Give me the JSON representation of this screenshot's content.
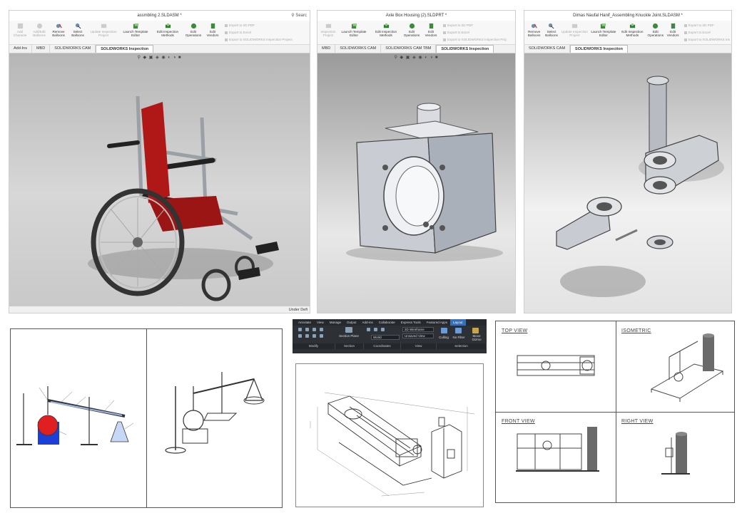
{
  "sw1": {
    "title": "assmbling 2.SLDASM *",
    "search": "Searc",
    "ribbon": [
      "Add Characte",
      "Add/Edit Balloons",
      "Remove Balloons",
      "Select Balloons",
      "Update Inspection Project",
      "Launch Template Editor",
      "Edit Inspection Methods",
      "Edit Operations",
      "Edit Vendors"
    ],
    "exports": [
      "Export to 2D PDF",
      "Export to Excel",
      "Export to SOLIDWORKS Inspection Project"
    ],
    "tabs": [
      "Add-Ins",
      "MBD",
      "SOLIDWORKS CAM",
      "SOLIDWORKS Inspection"
    ],
    "status": "Under Defi"
  },
  "sw2": {
    "title": "Axle Box Housing (2).SLDPRT *",
    "ribbon": [
      "Inspection Project",
      "Launch Template Editor",
      "Edit Inspection Methods",
      "Edit Operations",
      "Edit Vendors"
    ],
    "exports": [
      "Export to 2D PDF",
      "Export to Excel",
      "Export to SOLIDWORKS Inspection Proj"
    ],
    "tabs": [
      "MBD",
      "SOLIDWORKS CAM",
      "SOLIDWORKS CAM TBM",
      "SOLIDWORKS Inspection"
    ]
  },
  "sw3": {
    "title": "Dimas Naufal Hanif_Assembling Knuckle Joint.SLDASM *",
    "ribbon": [
      "Remove Balloons",
      "Select Balloons",
      "Update Inspection Project",
      "Launch Template Editor",
      "Edit Inspection Methods",
      "Edit Operations",
      "Edit Vendors"
    ],
    "exports": [
      "Export to 2D PDF",
      "Export to Excel",
      "Export to SOLIDWORKS Ins"
    ],
    "tabs": [
      "SOLIDWORKS CAM",
      "SOLIDWORKS Inspection"
    ]
  },
  "acad": {
    "tabs": [
      "Annotate",
      "View",
      "Manage",
      "Output",
      "Add-ins",
      "Collaborate",
      "Express Tools",
      "Featured Apps",
      "Layout"
    ],
    "groups": [
      "Modify",
      "Section",
      "Coordinates",
      "View",
      "Selection"
    ],
    "section_plane": "Section Plane",
    "visual_style": "2D Wireframe",
    "view_name": "Unsaved View",
    "ucs": "World",
    "culling": "Culling",
    "no_filter": "No Filter",
    "move_gizmo": "Move Gizmo"
  },
  "views": {
    "top": "TOP VIEW",
    "iso": "ISOMETRIC",
    "front": "FRONT VIEW",
    "right": "RIGHT VIEW"
  },
  "colors": {
    "seat_red": "#b01818",
    "flask_red": "#e02020",
    "stand_blue": "#1c3fd8",
    "acad_blue": "#3a6fb2",
    "acad_dark": "#2d3136"
  }
}
